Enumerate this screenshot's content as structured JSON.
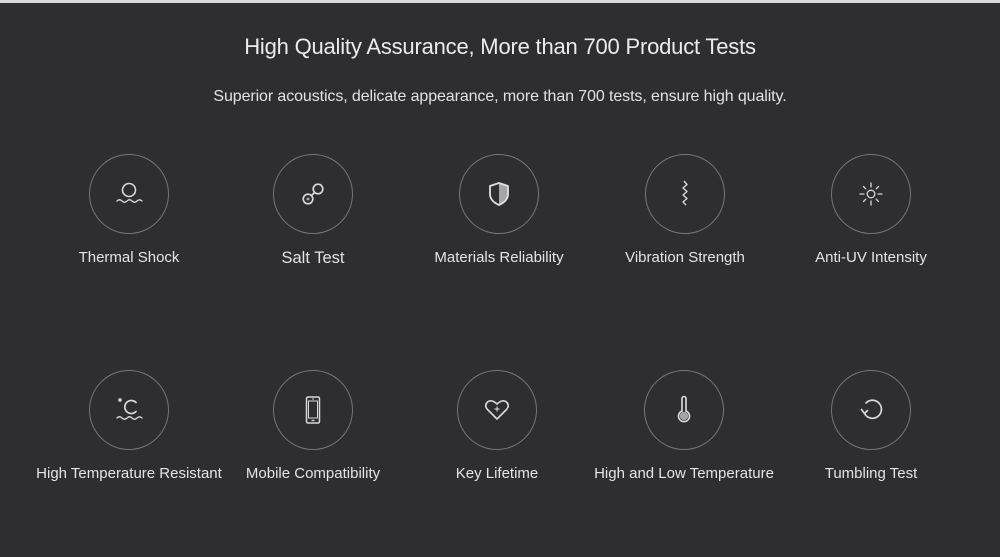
{
  "header": {
    "title": "High Quality Assurance, More than 700 Product Tests",
    "subtitle": "Superior acoustics, delicate appearance, more than 700 tests, ensure high quality."
  },
  "colors": {
    "background": "#2e2d32",
    "text": "#e6e6e6",
    "circle_border": "#77767b",
    "icon_stroke": "#d8d8d8"
  },
  "features": [
    {
      "label": "Thermal Shock",
      "icon": "thermal-shock-icon"
    },
    {
      "label": "Salt Test",
      "icon": "salt-molecule-icon"
    },
    {
      "label": "Materials Reliability",
      "icon": "shield-icon"
    },
    {
      "label": "Vibration Strength",
      "icon": "vibration-zigzag-icon"
    },
    {
      "label": "Anti-UV Intensity",
      "icon": "sun-icon"
    },
    {
      "label": "High Temperature Resistant",
      "icon": "celsius-heat-icon"
    },
    {
      "label": "Mobile Compatibility",
      "icon": "mobile-phone-icon"
    },
    {
      "label": "Key Lifetime",
      "icon": "heart-plus-icon"
    },
    {
      "label": "High and Low Temperature",
      "icon": "thermometer-icon"
    },
    {
      "label": "Tumbling Test",
      "icon": "rotate-icon"
    }
  ]
}
